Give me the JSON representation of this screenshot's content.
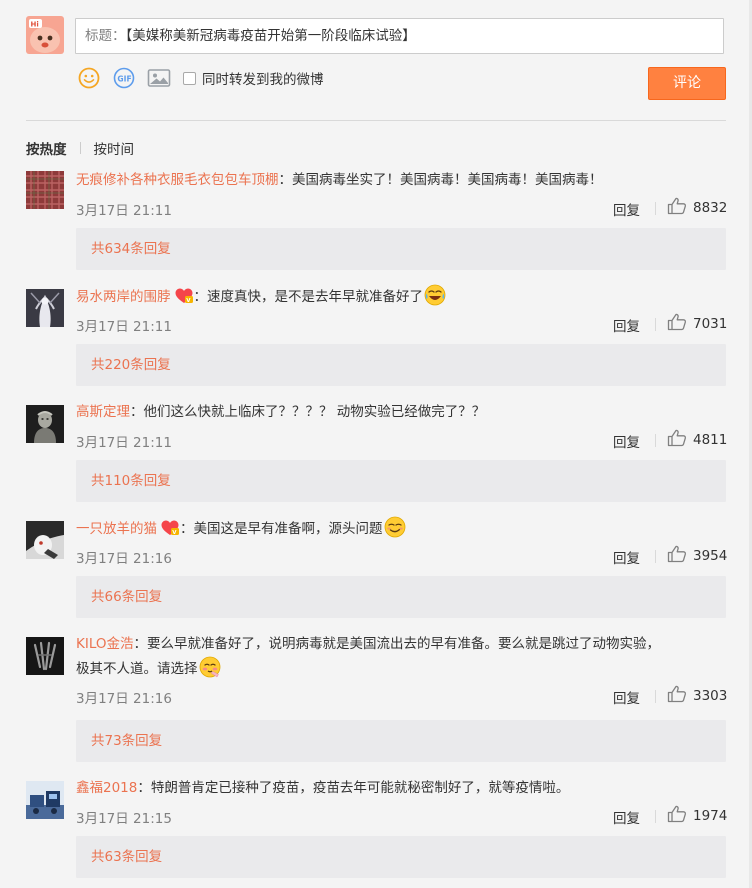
{
  "composer": {
    "title_prefix": "标题：",
    "title_value": "【美媒称美新冠病毒疫苗开始第一阶段临床试验】",
    "repost_label": "同时转发到我的微博",
    "submit_label": "评论",
    "tools": [
      "emoji-icon",
      "gif-icon",
      "image-icon"
    ]
  },
  "sort": {
    "hot_label": "按热度",
    "time_label": "按时间",
    "active": "hot"
  },
  "comments": [
    {
      "user": "无痕修补各种衣服毛衣包包车顶棚",
      "text_lines": [
        "：美国病毒坐实了！美国病毒！美国病毒！美国病毒！"
      ],
      "time": "3月17日 21:11",
      "reply_label": "回复",
      "likes": "8832",
      "more_replies": "共634条回复",
      "vip": false,
      "avatar_theme": "plaid-red"
    },
    {
      "user": "易水两岸的围脖",
      "text_lines": [
        "：速度真快，是不是去年早就准备好了"
      ],
      "emoji": "laugh-cry",
      "time": "3月17日 21:11",
      "reply_label": "回复",
      "likes": "7031",
      "more_replies": "共220条回复",
      "vip": true,
      "avatar_theme": "white-figure"
    },
    {
      "user": "高斯定理",
      "text_lines": [
        "：他们这么快就上临床了？？？？ 动物实验已经做完了？？"
      ],
      "time": "3月17日 21:11",
      "reply_label": "回复",
      "likes": "4811",
      "more_replies": "共110条回复",
      "vip": false,
      "avatar_theme": "bust"
    },
    {
      "user": "一只放羊的猫",
      "text_lines": [
        "：美国这是早有准备啊，源头问题"
      ],
      "emoji": "smirk",
      "time": "3月17日 21:16",
      "reply_label": "回复",
      "likes": "3954",
      "more_replies": "共66条回复",
      "vip": true,
      "avatar_theme": "dark-light"
    },
    {
      "user": "KILO金浩",
      "text_lines": [
        "：要么早就准备好了，说明病毒就是美国流出去的早有准备。要么就是跳过了动物实验，",
        "极其不人道。请选择"
      ],
      "emoji": "blush-shy",
      "time": "3月17日 21:16",
      "reply_label": "回复",
      "likes": "3303",
      "more_replies": "共73条回复",
      "vip": false,
      "avatar_theme": "dark-mark"
    },
    {
      "user": "鑫福2018",
      "text_lines": [
        "：特朗普肯定已接种了疫苗，疫苗去年可能就秘密制好了，就等疫情啦。"
      ],
      "time": "3月17日 21:15",
      "reply_label": "回复",
      "likes": "1974",
      "more_replies": "共63条回复",
      "vip": false,
      "avatar_theme": "scene-blue"
    }
  ],
  "colors": {
    "username": "#eb7350",
    "accent_button": "#ff8140",
    "time": "#808080",
    "more_bg": "#eaeaec",
    "background": "#f4f4f4"
  }
}
